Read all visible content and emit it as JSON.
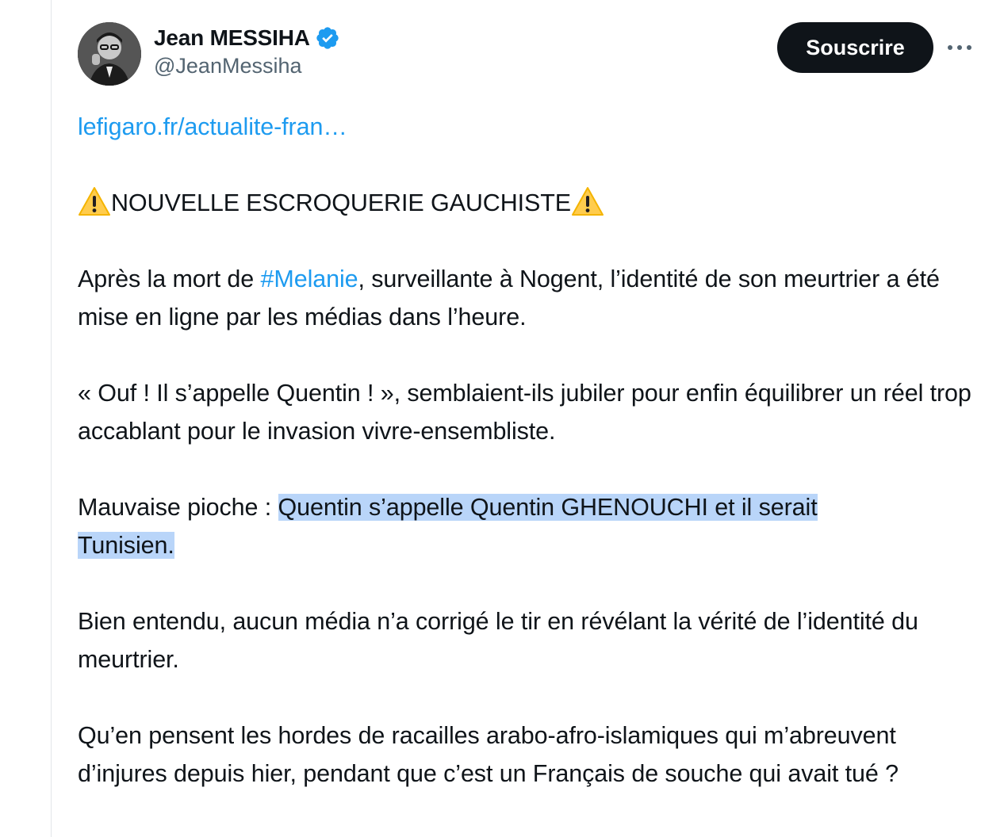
{
  "author": {
    "display_name": "Jean MESSIHA",
    "handle": "@JeanMessiha",
    "verified_color": "#1d9bf0"
  },
  "actions": {
    "subscribe_label": "Souscrire",
    "more_icon": "more-horizontal-icon"
  },
  "tweet": {
    "link_text": "lefigaro.fr/actualite-fran…",
    "headline": "NOUVELLE ESCROQUERIE GAUCHISTE",
    "headline_icon": "warning-icon",
    "p1_before": "Après la mort de ",
    "p1_hashtag": "#Melanie",
    "p1_after": ", surveillante à Nogent, l’identité de son meurtrier a été mise en ligne par les médias dans l’heure.",
    "p2": "« Ouf ! Il s’appelle Quentin ! », semblaient-ils jubiler pour enfin équilibrer un réel trop accablant pour le invasion vivre-ensembliste.",
    "p3_before": "Mauvaise pioche : ",
    "p3_highlight_line1": "Quentin s’appelle Quentin GHENOUCHI et il serait",
    "p3_highlight_line2": "Tunisien.",
    "p4": "Bien entendu, aucun média n’a corrigé le tir en révélant la vérité de l’identité du meurtrier.",
    "p5": "Qu’en pensent les hordes de racailles arabo-afro-islamiques qui m’abreuvent d’injures depuis hier, pendant que c’est un Français de souche qui avait tué ?"
  },
  "colors": {
    "link": "#1d9bf0",
    "highlight": "#b9d5f9",
    "button_bg": "#0f1419"
  }
}
